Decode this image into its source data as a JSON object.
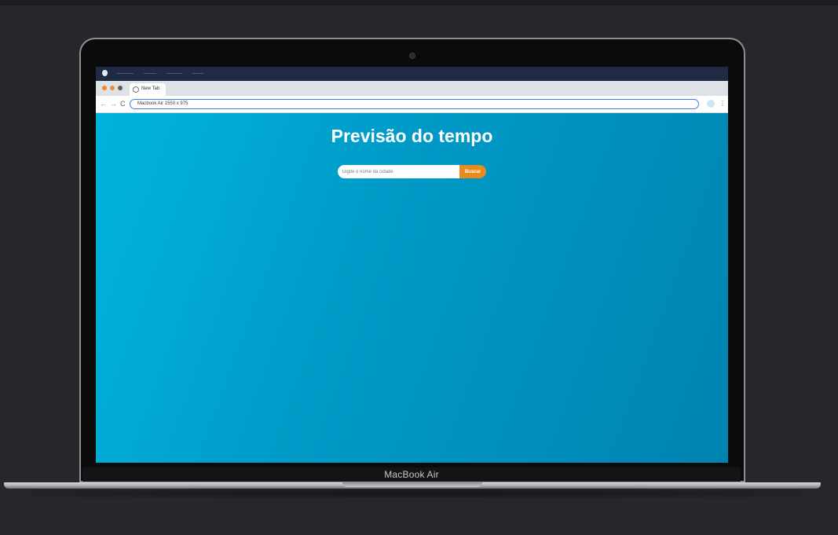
{
  "device": {
    "label": "MacBook Air"
  },
  "browser": {
    "tab_title": "New Tab",
    "address": "Macbook Air  1550 x 975",
    "window_controls": [
      "close",
      "minimize",
      "zoom"
    ],
    "colors": {
      "close": "#ec8a3a",
      "minimize": "#e88e35",
      "zoom": "#5a5c60"
    }
  },
  "weather_app": {
    "title": "Previsão do tempo",
    "search": {
      "placeholder": "Digite o nome da cidade",
      "value": "",
      "button_label": "Buscar"
    }
  },
  "colors": {
    "background": "#26272b",
    "page_gradient_start": "#00b4dc",
    "page_gradient_end": "#0083b1",
    "button": "#e98a1d"
  }
}
